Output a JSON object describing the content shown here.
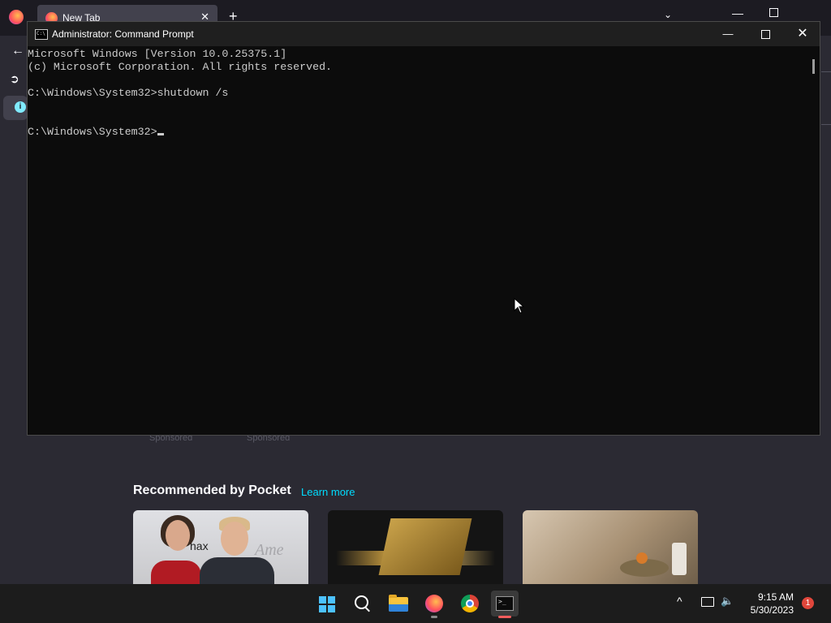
{
  "browser": {
    "tab_title": "New Tab",
    "tab_close": "✕",
    "new_tab": "+",
    "sponsored_label": "Sponsored",
    "pocket": {
      "heading": "Recommended by Pocket",
      "learn_more": "Learn more",
      "card1_text_a": "hax",
      "card1_text_b": "Ame"
    }
  },
  "cmd": {
    "title": "Administrator: Command Prompt",
    "icon_text": "C:\\",
    "minimize_glyph": "—",
    "close_glyph": "✕",
    "lines": [
      "Microsoft Windows [Version 10.0.25375.1]",
      "(c) Microsoft Corporation. All rights reserved.",
      "",
      "C:\\Windows\\System32>shutdown /s",
      "",
      "",
      "C:\\Windows\\System32>"
    ]
  },
  "taskbar": {
    "apps": [
      "start-button",
      "search",
      "file-explorer",
      "firefox",
      "chrome",
      "terminal"
    ],
    "terminal_icon_text": ">_",
    "tray_chevron": "^",
    "time": "9:15 AM",
    "date": "5/30/2023",
    "notification_count": "1"
  }
}
